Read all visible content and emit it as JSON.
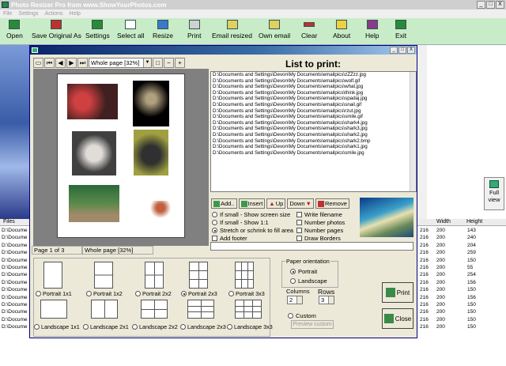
{
  "window": {
    "title": "Photo Resizer Pro from www.ShowYourPhotos.com",
    "min": "_",
    "max": "□",
    "close": "X"
  },
  "menu": [
    "File",
    "Settings",
    "Actions",
    "Help"
  ],
  "toolbar": [
    {
      "label": "Open",
      "icon": "open-folder-icon",
      "color": "#2a8a3a"
    },
    {
      "label": "Save Original As",
      "icon": "save-icon",
      "color": "#c03030"
    },
    {
      "label": "Settings",
      "icon": "settings-icon",
      "color": "#2a8a3a"
    },
    {
      "label": "Select all",
      "icon": "select-all-icon",
      "color": "#ffffff"
    },
    {
      "label": "Resize",
      "icon": "resize-icon",
      "color": "#3a7ac8"
    },
    {
      "label": "Print",
      "icon": "printer-icon",
      "color": "#d0d0d0"
    },
    {
      "label": "Email resized",
      "icon": "email-icon",
      "color": "#e0d060"
    },
    {
      "label": "Own email",
      "icon": "own-email-icon",
      "color": "#e0d060"
    },
    {
      "label": "Clear",
      "icon": "clear-icon",
      "color": "#c03030"
    },
    {
      "label": "About",
      "icon": "about-icon",
      "color": "#f0d040"
    },
    {
      "label": "Help",
      "icon": "help-book-icon",
      "color": "#8a3a8a"
    },
    {
      "label": "Exit",
      "icon": "exit-icon",
      "color": "#2a8a3a"
    }
  ],
  "fullview": {
    "label": "Full view"
  },
  "files": {
    "header": {
      "files": "Files",
      "width": "Width",
      "height": "Height"
    },
    "rows": [
      {
        "path": "D:\\Docume",
        "w1": "216",
        "w": "200",
        "h": "143"
      },
      {
        "path": "D:\\Docume",
        "w1": "216",
        "w": "200",
        "h": "240"
      },
      {
        "path": "D:\\Docume",
        "w1": "216",
        "w": "200",
        "h": "204"
      },
      {
        "path": "D:\\Docume",
        "w1": "216",
        "w": "200",
        "h": "259"
      },
      {
        "path": "D:\\Docume",
        "w1": "216",
        "w": "200",
        "h": "150"
      },
      {
        "path": "D:\\Docume",
        "w1": "216",
        "w": "200",
        "h": "55"
      },
      {
        "path": "D:\\Docume",
        "w1": "216",
        "w": "200",
        "h": "254"
      },
      {
        "path": "D:\\Docume",
        "w1": "216",
        "w": "200",
        "h": "156"
      },
      {
        "path": "D:\\Docume",
        "w1": "216",
        "w": "200",
        "h": "150"
      },
      {
        "path": "D:\\Docume",
        "w1": "216",
        "w": "200",
        "h": "156"
      },
      {
        "path": "D:\\Docume",
        "w1": "216",
        "w": "200",
        "h": "150"
      },
      {
        "path": "D:\\Docume",
        "w1": "216",
        "w": "200",
        "h": "150"
      },
      {
        "path": "D:\\Docume",
        "w1": "216",
        "w": "200",
        "h": "150"
      },
      {
        "path": "D:\\Docume",
        "w1": "216",
        "w": "200",
        "h": "150"
      }
    ]
  },
  "dialog": {
    "zoom": "Whole page [32%]",
    "status": {
      "page": "Page 1 of 3",
      "zoom": "Whole page [32%]"
    },
    "list_title": "List to print:",
    "list": [
      "D:\\Documents and Settings\\Devon\\My Documents\\emailpics\\zZZzz.jpg",
      "D:\\Documents and Settings\\Devon\\My Documents\\emailpics\\wolf.gif",
      "D:\\Documents and Settings\\Devon\\My Documents\\emailpics\\what.jpg",
      "D:\\Documents and Settings\\Devon\\My Documents\\emailpics\\think.jpg",
      "D:\\Documents and Settings\\Devon\\My Documents\\emailpics\\spadaj.jpg",
      "D:\\Documents and Settings\\Devon\\My Documents\\emailpics\\snail.gif",
      "D:\\Documents and Settings\\Devon\\My Documents\\emailpics\\rzut.jpg",
      "D:\\Documents and Settings\\Devon\\My Documents\\emailpics\\smile.gif",
      "D:\\Documents and Settings\\Devon\\My Documents\\emailpics\\shark4.jpg",
      "D:\\Documents and Settings\\Devon\\My Documents\\emailpics\\shark3.jpg",
      "D:\\Documents and Settings\\Devon\\My Documents\\emailpics\\shark2.jpg",
      "D:\\Documents and Settings\\Devon\\My Documents\\emailpics\\shark2.bmp",
      "D:\\Documents and Settings\\Devon\\My Documents\\emailpics\\shark1.jpg",
      "D:\\Documents and Settings\\Devon\\My Documents\\emailpics\\smile.jpg"
    ],
    "list_buttons": {
      "add": "Add..",
      "insert": "Insert",
      "up": "Up",
      "down": "Down",
      "remove": "Remove"
    },
    "options": {
      "show_screen": "If small - Show screen size",
      "show_11": "If small - Show 1:1",
      "stretch": "Stretch or schrink to fill area",
      "footer": "Add footer",
      "write_filename": "Write filename",
      "number_photos": "Number photos",
      "number_pages": "Number pages",
      "draw_borders": "Draw Borders"
    },
    "layouts": [
      "Portrait 1x1",
      "Portrait 1x2",
      "Portrait 2x2",
      "Portrait 2x3",
      "Portrait 3x3",
      "Landscape 1x1",
      "Landscape 2x1",
      "Landscape 2x2",
      "Landscape 2x3",
      "Landscape 3x3"
    ],
    "orientation": {
      "legend": "Paper orientation",
      "portrait": "Portrait",
      "landscape": "Landscape"
    },
    "columns": {
      "label": "Columns",
      "value": "2"
    },
    "rows": {
      "label": "Rows",
      "value": "3"
    },
    "custom": "Custom",
    "preview_custom": "Preview custom",
    "print": "Print",
    "close": "Close"
  }
}
